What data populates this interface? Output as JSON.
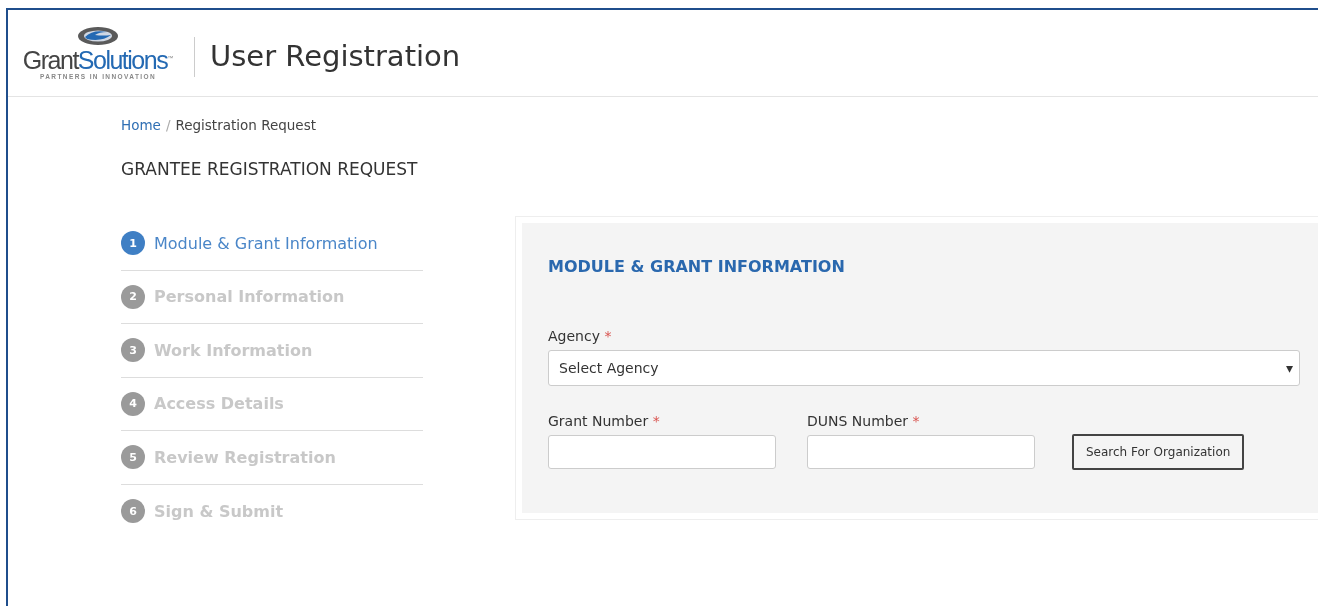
{
  "header": {
    "logo": {
      "wordmark": [
        "Grant",
        "Solutions"
      ],
      "trademark": "™",
      "tagline": "PARTNERS IN INNOVATION"
    },
    "title": "User Registration"
  },
  "breadcrumb": [
    {
      "label": "Home",
      "link": true
    },
    {
      "label": "Registration Request",
      "link": false
    }
  ],
  "breadcrumb_separator": "/",
  "page_heading": "GRANTEE REGISTRATION REQUEST",
  "steps": [
    {
      "number": "1",
      "label": "Module & Grant Information",
      "selected": true
    },
    {
      "number": "2",
      "label": "Personal Information",
      "selected": false
    },
    {
      "number": "3",
      "label": "Work Information",
      "selected": false
    },
    {
      "number": "4",
      "label": "Access Details",
      "selected": false
    },
    {
      "number": "5",
      "label": "Review Registration",
      "selected": false
    },
    {
      "number": "6",
      "label": "Sign & Submit",
      "selected": false
    }
  ],
  "form": {
    "title": "MODULE & GRANT INFORMATION",
    "agency": {
      "label": "Agency",
      "required_mark": "*",
      "value": "Select Agency",
      "caret": "▾"
    },
    "fields": [
      {
        "label": "Grant Number",
        "required_mark": "*"
      },
      {
        "label": "DUNS Number",
        "required_mark": "*"
      }
    ],
    "search_button": "Search For Organization"
  }
}
